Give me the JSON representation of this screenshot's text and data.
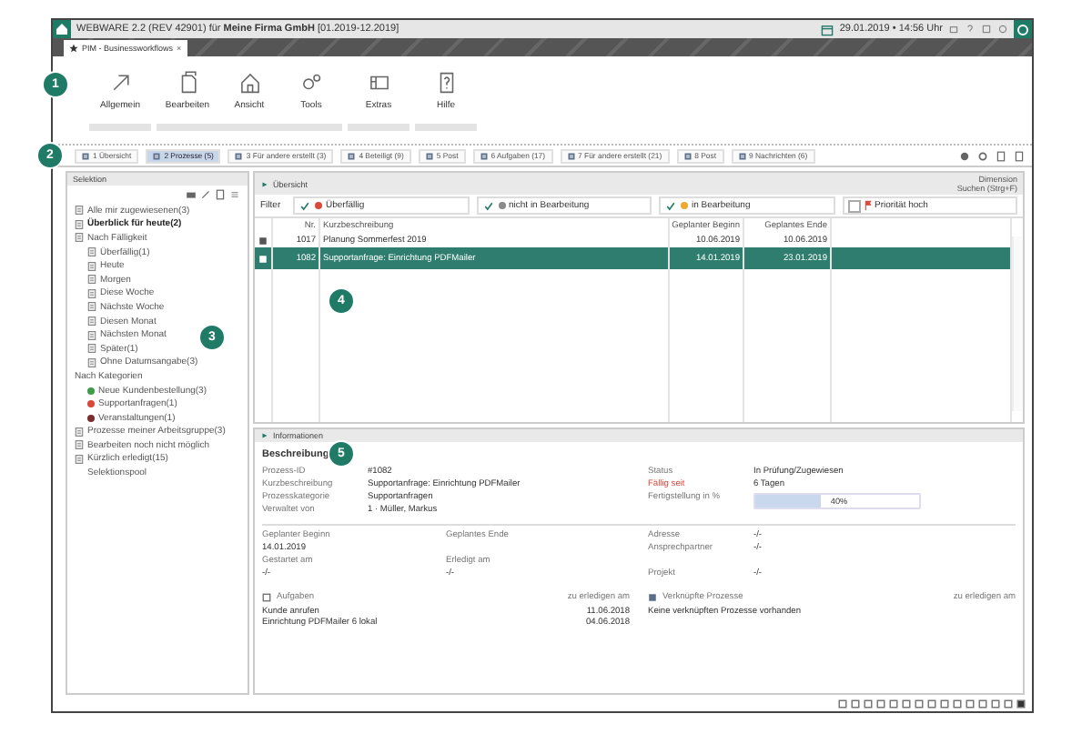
{
  "window": {
    "title": "WEBWARE 2.2 (REV 42901) für **Meine Firma GmbH** [01.2019-12.2019]",
    "datetime": "29.01.2019 • 14:56 Uhr"
  },
  "doc_tabs": [
    {
      "label": "PIM - Businessworkflows",
      "close": "×",
      "selected": true
    }
  ],
  "ribbon": {
    "callout": "1",
    "groups": [
      {
        "buttons": [
          "Allgemein"
        ]
      },
      {
        "buttons": [
          "Bearbeiten",
          "Ansicht",
          "Tools"
        ]
      },
      {
        "buttons": [
          "Extras"
        ]
      },
      {
        "buttons": [
          "Hilfe"
        ]
      }
    ]
  },
  "view_tabs": {
    "callout": "2",
    "tabs": [
      {
        "label": "1 Übersicht",
        "selected": false
      },
      {
        "label": "2 Prozesse (5)",
        "selected": true
      },
      {
        "label": "3 Für andere erstellt (3)",
        "selected": false
      },
      {
        "label": "4 Beteiligt (9)",
        "selected": false
      },
      {
        "label": "5 Post",
        "selected": false
      },
      {
        "label": "6 Aufgaben (17)",
        "selected": false
      },
      {
        "label": "7 Für andere erstellt (21)",
        "selected": false
      },
      {
        "label": "8 Post",
        "selected": false
      },
      {
        "label": "9 Nachrichten (6)",
        "selected": false
      }
    ]
  },
  "selection": {
    "title": "Selektion",
    "callout": "3",
    "items": [
      {
        "label": "Alle mir zugewiesenen(3)",
        "kind": "doc",
        "selected": false
      },
      {
        "label": "Überblick für heute(2)",
        "kind": "doc",
        "selected": true
      },
      {
        "label": "Nach Fälligkeit",
        "kind": "doc",
        "selected": false,
        "children": [
          {
            "label": "Überfällig(1)",
            "kind": "doc",
            "selected": false
          },
          {
            "label": "Heute",
            "kind": "doc",
            "selected": false
          },
          {
            "label": "Morgen",
            "kind": "doc",
            "selected": false
          },
          {
            "label": "Diese Woche",
            "kind": "doc",
            "selected": false
          },
          {
            "label": "Nächste Woche",
            "kind": "doc",
            "selected": false
          },
          {
            "label": "Diesen Monat",
            "kind": "doc",
            "selected": false
          },
          {
            "label": "Nächsten Monat",
            "kind": "doc",
            "selected": false
          },
          {
            "label": "Später(1)",
            "kind": "doc",
            "selected": false
          },
          {
            "label": "Ohne Datumsangabe(3)",
            "kind": "doc",
            "selected": false
          }
        ]
      },
      {
        "label": "Nach Kategorien",
        "kind": "label",
        "selected": false,
        "children": [
          {
            "label": "Neue Kundenbestellung(3)",
            "kind": "dot",
            "color": "#3f9a4a",
            "selected": false
          },
          {
            "label": "Supportanfragen(1)",
            "kind": "dot",
            "color": "#d9483b",
            "selected": false
          },
          {
            "label": "Veranstaltungen(1)",
            "kind": "dot",
            "color": "#7a2e2e",
            "selected": false
          }
        ]
      },
      {
        "label": "Prozesse meiner Arbeitsgruppe(3)",
        "kind": "doc",
        "selected": false
      },
      {
        "label": "Bearbeiten noch nicht möglich",
        "kind": "doc",
        "selected": false
      },
      {
        "label": "Kürzlich erledigt(15)",
        "kind": "doc",
        "selected": false,
        "children": [
          {
            "label": "Selektionspool",
            "kind": "label",
            "selected": false
          }
        ]
      }
    ]
  },
  "overview": {
    "title": "Übersicht",
    "callout": "4",
    "dimension": "Dimension",
    "search": "Suchen (Strg+F)",
    "filter_label": "Filter",
    "filters": [
      {
        "label": "Überfällig",
        "kind": "dot",
        "color": "#d9483b",
        "checked": true
      },
      {
        "label": "nicht in Bearbeitung",
        "kind": "dot",
        "color": "#8a8a8a",
        "checked": true
      },
      {
        "label": "in Bearbeitung",
        "kind": "dot",
        "color": "#f0a830",
        "checked": true
      },
      {
        "label": "Priorität hoch",
        "kind": "flag",
        "color": "#d9483b",
        "checked": false
      }
    ],
    "columns": [
      "Nr.",
      "Kurzbeschreibung",
      "Geplanter Beginn",
      "Geplantes Ende"
    ],
    "rows": [
      {
        "nr": "1017",
        "text": "Planung Sommerfest 2019",
        "begin": "10.06.2019",
        "end": "10.06.2019",
        "selected": false
      },
      {
        "nr": "1082",
        "text": "Supportanfrage: Einrichtung PDFMailer",
        "begin": "14.01.2019",
        "end": "23.01.2019",
        "selected": true
      }
    ]
  },
  "info": {
    "title": "Informationen",
    "heading": "Beschreibung",
    "callout": "5",
    "left": [
      {
        "label": "Prozess-ID",
        "value": "#1082"
      },
      {
        "label": "Kurzbeschreibung",
        "value": "Supportanfrage: Einrichtung PDFMailer"
      },
      {
        "label": "Prozesskategorie",
        "value": "Supportanfragen"
      },
      {
        "label": "Verwaltet von",
        "value": "1 · Müller, Markus"
      }
    ],
    "right": [
      {
        "label": "Status",
        "value": "In Prüfung/Zugewiesen",
        "kind": "text"
      },
      {
        "label": "Fällig seit",
        "value": "6 Tagen",
        "kind": "alert"
      },
      {
        "label": "Fertigstellung in %",
        "value": "40%",
        "kind": "progress",
        "level": 0.4
      }
    ],
    "dates": [
      {
        "label": "Geplanter Beginn",
        "value": "14.01.2019"
      },
      {
        "label": "Geplantes Ende"
      },
      {
        "label": "Gestartet am",
        "value": "-/-"
      },
      {
        "label": "Erledigt am",
        "value": "-/-"
      }
    ],
    "contacts": [
      {
        "label": "Adresse",
        "value": "-/-"
      },
      {
        "label": "Ansprechpartner",
        "value": "-/-"
      },
      {
        "label": "Projekt",
        "value": "-/-"
      }
    ],
    "tasks": {
      "title": "Aufgaben",
      "due": "zu erledigen am",
      "rows": [
        {
          "text": "Kunde anrufen",
          "date": "11.06.2018"
        },
        {
          "text": "Einrichtung PDFMailer 6 lokal",
          "date": "04.06.2018"
        }
      ]
    },
    "linked": {
      "title": "Verknüpfte Prozesse",
      "due": "zu erledigen am",
      "empty": "Keine verknüpften Prozesse vorhanden"
    }
  }
}
